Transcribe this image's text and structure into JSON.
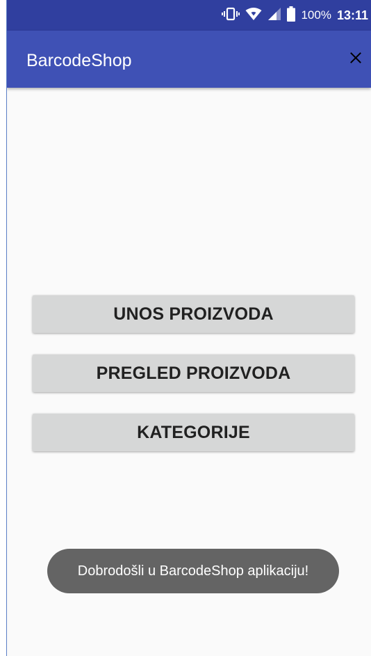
{
  "status_bar": {
    "battery_percent": "100%",
    "time": "13:11",
    "icons": [
      "vibrate-icon",
      "wifi-icon",
      "cell-signal-icon",
      "battery-icon"
    ]
  },
  "app_bar": {
    "title": "BarcodeShop",
    "close_icon": "close-icon"
  },
  "menu": {
    "buttons": [
      {
        "label": "UNOS PROIZVODA"
      },
      {
        "label": "PREGLED PROIZVODA"
      },
      {
        "label": "KATEGORIJE"
      }
    ]
  },
  "toast": {
    "message": "Dobrodošli u BarcodeShop aplikaciju!"
  },
  "colors": {
    "status_bar": "#303f9f",
    "app_bar": "#3f51b5",
    "background": "#fafafa",
    "button": "#d6d7d7",
    "toast": "#646464"
  }
}
